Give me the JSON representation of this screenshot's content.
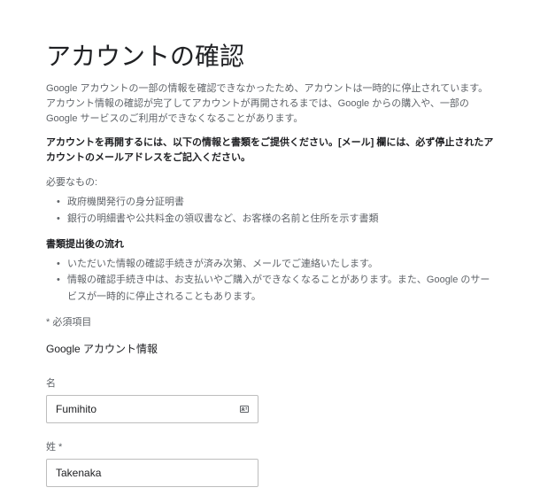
{
  "page": {
    "title": "アカウントの確認",
    "intro": "Google アカウントの一部の情報を確認できなかったため、アカウントは一時的に停止されています。アカウント情報の確認が完了してアカウントが再開されるまでは、Google からの購入や、一部の Google サービスのご利用ができなくなることがあります。",
    "instruction": "アカウントを再開するには、以下の情報と書類をご提供ください。[メール] 欄には、必ず停止されたアカウントのメールアドレスをご記入ください。",
    "necessary_label": "必要なもの:",
    "necessary_items": [
      "政府機関発行の身分証明書",
      "銀行の明細書や公共料金の領収書など、お客様の名前と住所を示す書類"
    ],
    "flow_head": "書類提出後の流れ",
    "flow_items": [
      "いただいた情報の確認手続きが済み次第、メールでご連絡いたします。",
      "情報の確認手続き中は、お支払いやご購入ができなくなることがあります。また、Google のサービスが一時的に停止されることもあります。"
    ],
    "required_note": "* 必須項目",
    "form_section": "Google アカウント情報",
    "first_name_label": "名",
    "first_name_value": "Fumihito",
    "last_name_label": "姓 *",
    "last_name_value": "Takenaka"
  }
}
